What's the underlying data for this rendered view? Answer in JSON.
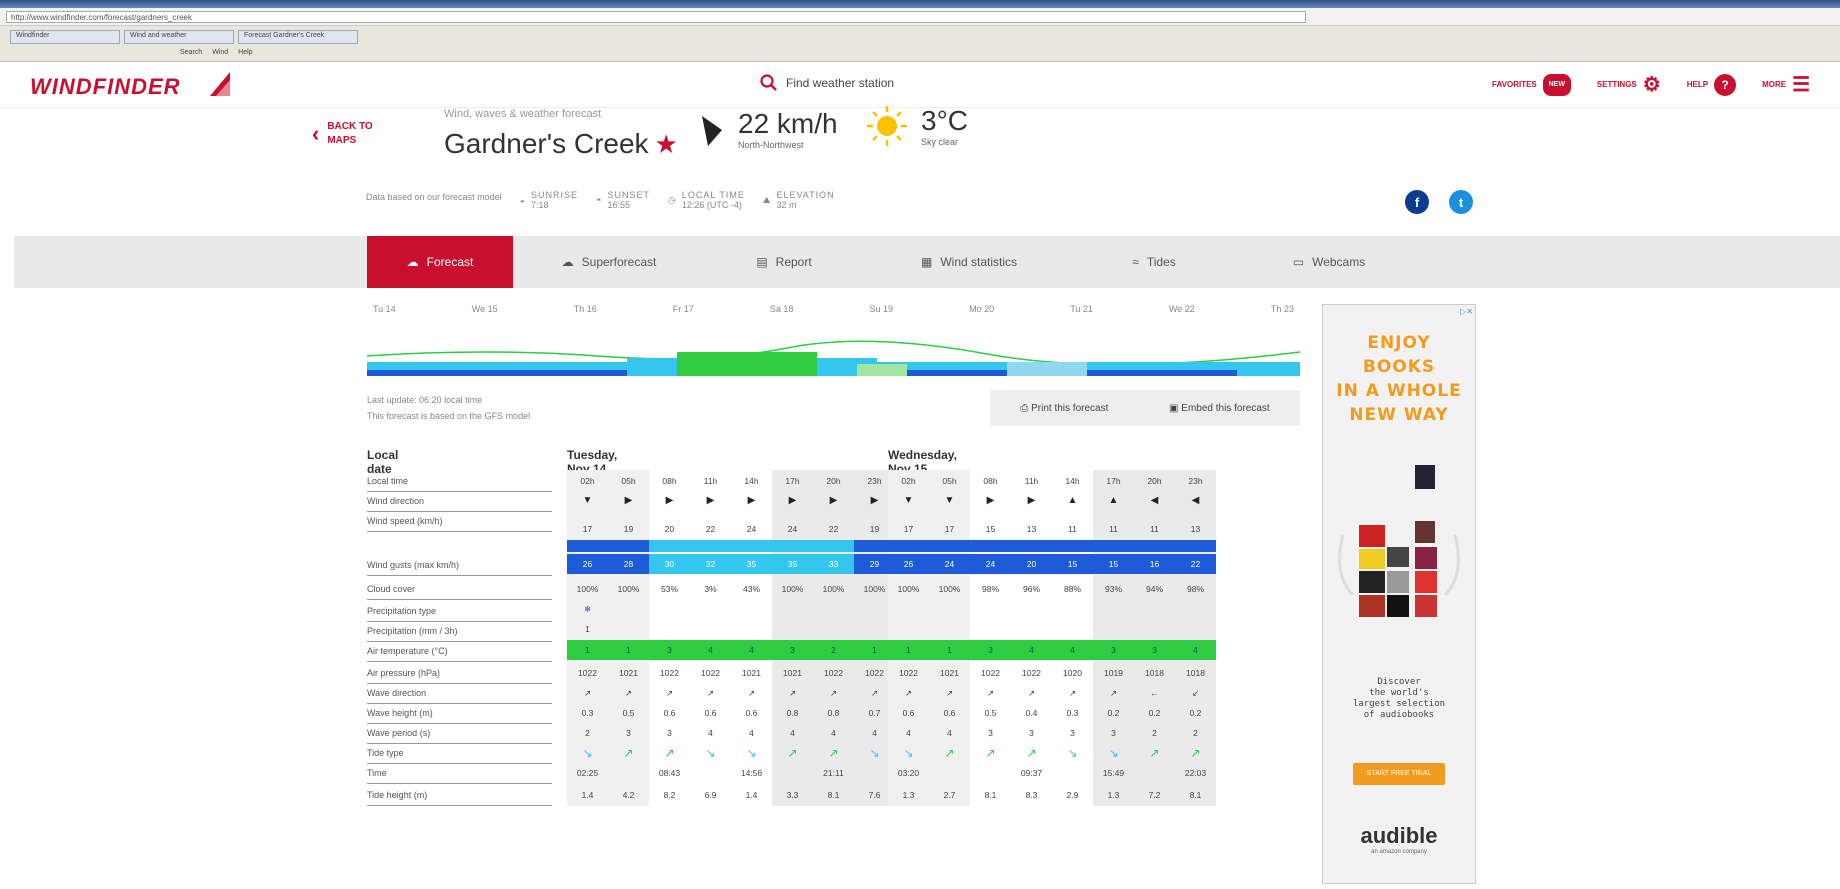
{
  "browser": {
    "address": "http://www.windfinder.com/forecast/gardners_creek",
    "tabs": [
      "Windfinder",
      "Wind and weather",
      "Forecast Gardner's Creek"
    ],
    "toolbar": [
      "Search",
      "Wind",
      "Help"
    ]
  },
  "header": {
    "logo": "WINDFINDER",
    "search_label": "Find weather station",
    "nav": [
      {
        "label": "FAVORITES",
        "badge": "NEW"
      },
      {
        "label": "SETTINGS"
      },
      {
        "label": "HELP"
      },
      {
        "label": "MORE"
      }
    ]
  },
  "spot": {
    "back_label_1": "BACK TO",
    "back_label_2": "MAPS",
    "subtitle": "Wind, waves & weather forecast",
    "name": "Gardner's Creek",
    "wind_value": "22 km/h",
    "wind_dir_text": "North-Northwest",
    "temp_value": "3°C",
    "sky_text": "Sky clear"
  },
  "meta": {
    "intro": "Data based on our forecast model",
    "items": [
      {
        "label": "SUNRISE",
        "value": "7:18"
      },
      {
        "label": "SUNSET",
        "value": "16:55"
      },
      {
        "label": "LOCAL TIME",
        "value": "12:26 (UTC -4)"
      },
      {
        "label": "ELEVATION",
        "value": "32 m"
      }
    ]
  },
  "tabs": [
    "Forecast",
    "Superforecast",
    "Report",
    "Wind statistics",
    "Tides",
    "Webcams"
  ],
  "overview": {
    "days": [
      "Tu 14",
      "We 15",
      "Th 16",
      "Fr 17",
      "Sa 18",
      "Su 19",
      "Mo 20",
      "Tu 21",
      "We 22",
      "Th 23"
    ]
  },
  "update": {
    "line1": "Last update: 06:20 local time",
    "line2": "This forecast is based on the GFS model"
  },
  "actions": {
    "print": "Print this forecast",
    "embed": "Embed this forecast"
  },
  "table": {
    "header": "Local date",
    "row_labels": [
      "Local time",
      "Wind direction",
      "Wind speed (km/h)",
      "Wind gusts (max km/h)",
      "Cloud cover",
      "Precipitation type",
      "Precipitation (mm / 3h)",
      "Air temperature (°C)",
      "Air pressure (hPa)",
      "Wave direction",
      "Wave height (m)",
      "Wave period (s)",
      "Tide type",
      "Time",
      "Tide height (m)"
    ],
    "days": [
      {
        "title": "Tuesday, Nov 14",
        "hours": [
          "02h",
          "05h",
          "08h",
          "11h",
          "14h",
          "17h",
          "20h",
          "23h"
        ],
        "wind_dir": [
          "▼",
          "▶",
          "▶",
          "▶",
          "▶",
          "▶",
          "▶",
          "▶"
        ],
        "wind_speed": [
          "17",
          "19",
          "20",
          "22",
          "24",
          "24",
          "22",
          "19"
        ],
        "gusts": [
          "26",
          "28",
          "30",
          "32",
          "35",
          "35",
          "33",
          "29"
        ],
        "cloud": [
          "100%",
          "100%",
          "53%",
          "3%",
          "43%",
          "100%",
          "100%",
          "100%"
        ],
        "precip_type": [
          "❄",
          "",
          "",
          "",
          "",
          "",
          "",
          ""
        ],
        "precip": [
          "1",
          "",
          "",
          "",
          "",
          "",
          "",
          ""
        ],
        "temp": [
          "1",
          "1",
          "3",
          "4",
          "4",
          "3",
          "2",
          "1"
        ],
        "pressure": [
          "1022",
          "1021",
          "1022",
          "1022",
          "1021",
          "1021",
          "1022",
          "1022"
        ],
        "wave_dir": [
          "↗",
          "↗",
          "↗",
          "↗",
          "↗",
          "↗",
          "↗",
          "↗"
        ],
        "wave_height": [
          "0.3",
          "0.5",
          "0.6",
          "0.6",
          "0.6",
          "0.8",
          "0.8",
          "0.7"
        ],
        "wave_period": [
          "2",
          "3",
          "3",
          "4",
          "4",
          "4",
          "4",
          "4"
        ],
        "tide_type": [
          "↘",
          "↗",
          "↗",
          "↘",
          "↘",
          "↗",
          "↗",
          "↘"
        ],
        "tide_time": [
          "02:25",
          "",
          "08:43",
          "",
          "14:56",
          "",
          "21:11",
          ""
        ],
        "tide_height": [
          "1.4",
          "4.2",
          "8.2",
          "6.9",
          "1.4",
          "3.3",
          "8.1",
          "7.6"
        ]
      },
      {
        "title": "Wednesday, Nov 15",
        "hours": [
          "02h",
          "05h",
          "08h",
          "11h",
          "14h",
          "17h",
          "20h",
          "23h"
        ],
        "wind_dir": [
          "▼",
          "▼",
          "▶",
          "▶",
          "▲",
          "▲",
          "◀",
          "◀"
        ],
        "wind_speed": [
          "17",
          "17",
          "15",
          "13",
          "11",
          "11",
          "11",
          "13"
        ],
        "gusts": [
          "26",
          "24",
          "24",
          "20",
          "15",
          "15",
          "16",
          "22"
        ],
        "cloud": [
          "100%",
          "100%",
          "98%",
          "96%",
          "88%",
          "93%",
          "94%",
          "98%"
        ],
        "precip_type": [
          "",
          "",
          "",
          "",
          "",
          "",
          "",
          ""
        ],
        "precip": [
          "",
          "",
          "",
          "",
          "",
          "",
          "",
          ""
        ],
        "temp": [
          "1",
          "1",
          "3",
          "4",
          "4",
          "3",
          "3",
          "4"
        ],
        "pressure": [
          "1022",
          "1021",
          "1022",
          "1022",
          "1020",
          "1019",
          "1018",
          "1018"
        ],
        "wave_dir": [
          "↗",
          "↗",
          "↗",
          "↗",
          "↗",
          "↗",
          "←",
          "↙"
        ],
        "wave_height": [
          "0.6",
          "0.6",
          "0.5",
          "0.4",
          "0.3",
          "0.2",
          "0.2",
          "0.2"
        ],
        "wave_period": [
          "4",
          "4",
          "3",
          "3",
          "3",
          "3",
          "2",
          "2"
        ],
        "tide_type": [
          "↘",
          "↗",
          "↗",
          "↗",
          "↘",
          "↘",
          "↗",
          "↗"
        ],
        "tide_time": [
          "03:20",
          "",
          "",
          "09:37",
          "",
          "15:49",
          "",
          "22:03"
        ],
        "tide_height": [
          "1.3",
          "2.7",
          "8.1",
          "8.3",
          "2.9",
          "1.3",
          "7.2",
          "8.1"
        ]
      }
    ]
  },
  "ad": {
    "headline": [
      "ENJOY",
      "BOOKS",
      "IN A WHOLE",
      "NEW WAY"
    ],
    "discover": [
      "Discover",
      "the world's",
      "largest selection",
      "of audiobooks"
    ],
    "cta": "START FREE TRIAL",
    "brand": "audible",
    "brand_sub": "an amazon company",
    "close": "▷✕"
  },
  "colors": {
    "brand": "#c8102e",
    "green": "#2ecc40",
    "blue": "#1e5bd8",
    "cyan": "#35c6f0"
  }
}
